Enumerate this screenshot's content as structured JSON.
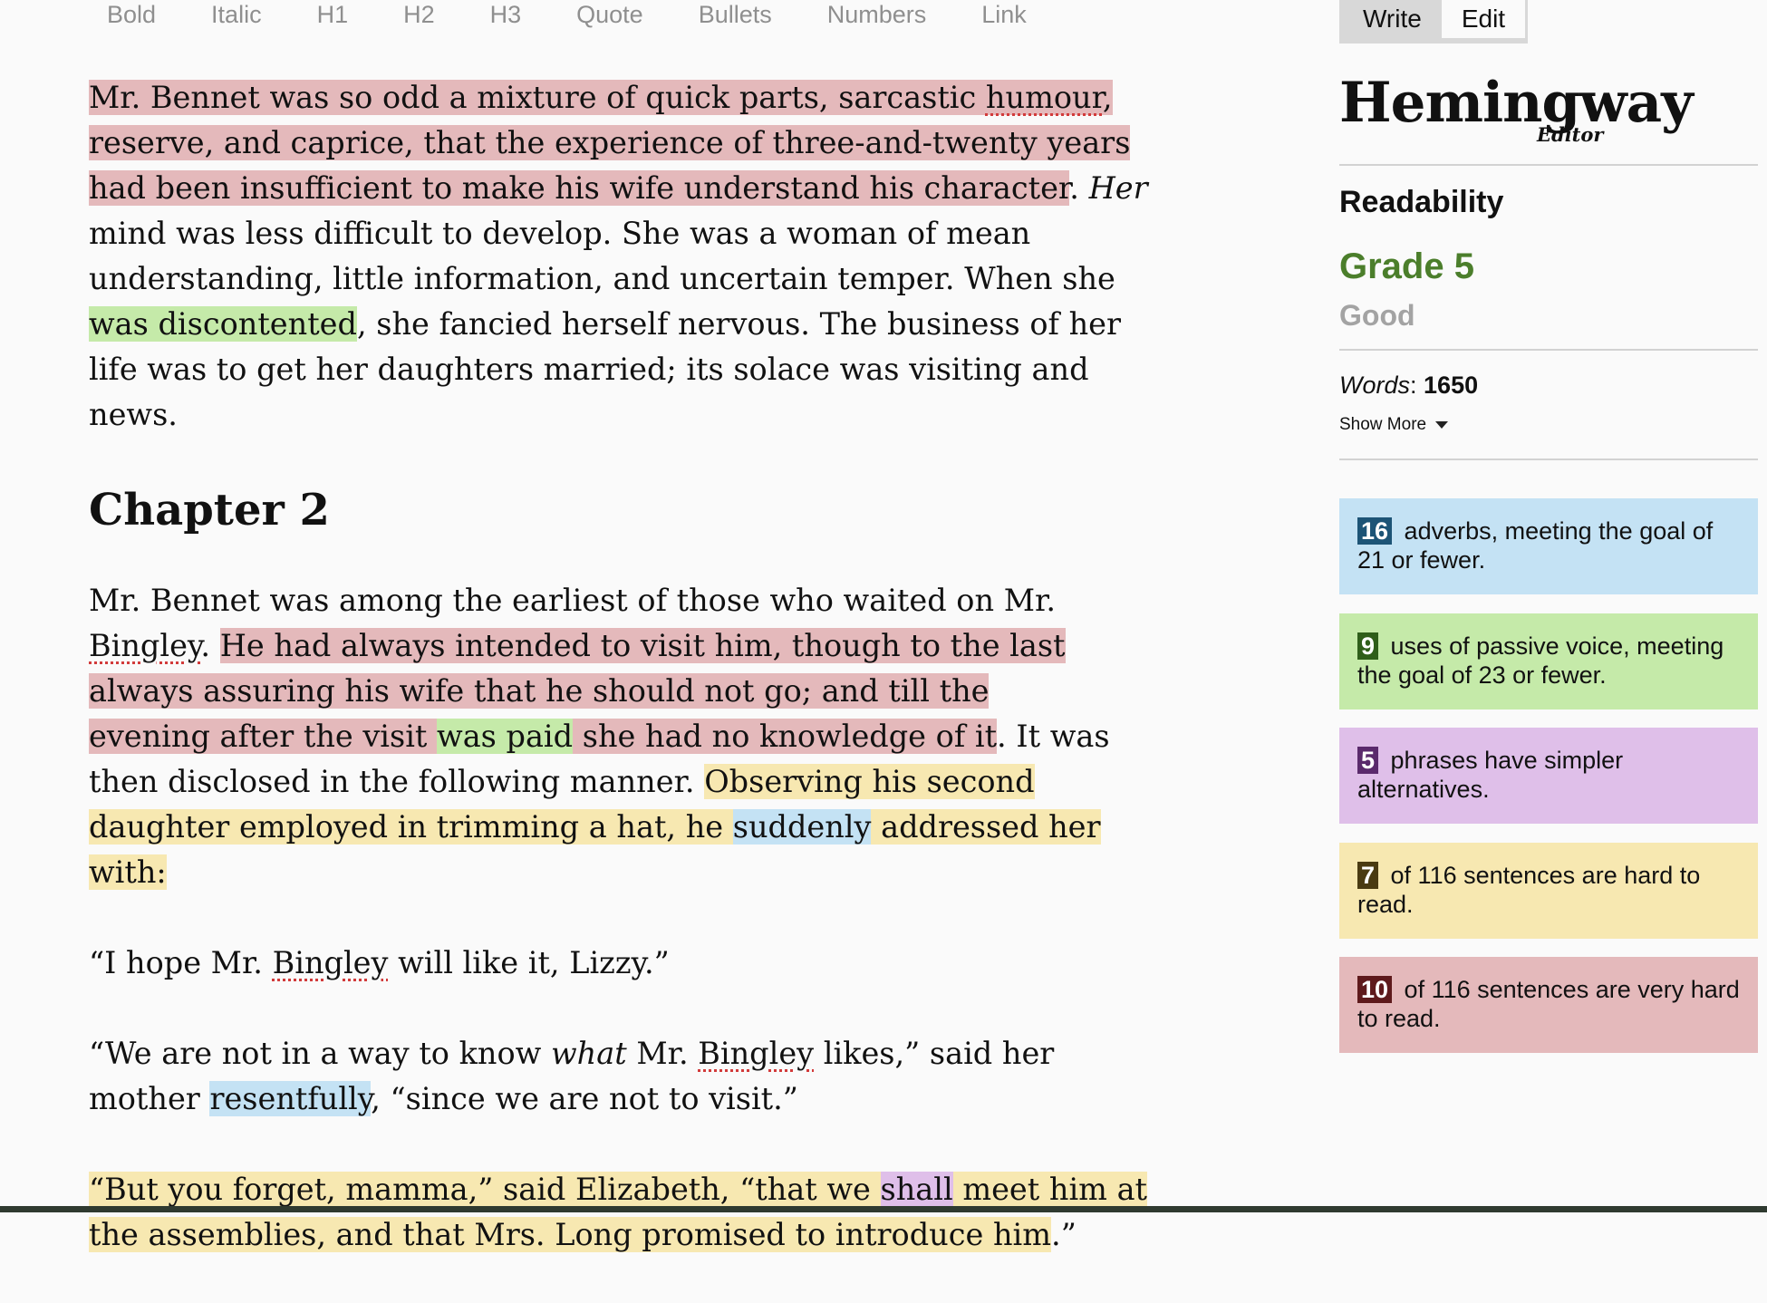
{
  "toolbar": {
    "items": [
      "Bold",
      "Italic",
      "H1",
      "H2",
      "H3",
      "Quote",
      "Bullets",
      "Numbers",
      "Link"
    ]
  },
  "editor": {
    "p1": {
      "s1": "Mr. Bennet was so odd a mixture of quick parts, sarcastic ",
      "s1_sp": "humour",
      "s1_b": ", reserve, and caprice, that the experience of three-and-twenty years had been insufficient to make his wife understand his character",
      "s1_end": ". ",
      "her": "Her",
      "s2": " mind was less difficult to develop. She was a woman of mean understanding, little information, and uncertain temper. When she ",
      "passive": "was discontented",
      "s3": ", she fancied herself nervous. The business of her life was to get her daughters married; its solace was visiting and news."
    },
    "chapter": "Chapter 2",
    "p2": {
      "a": "Mr. Bennet was among the earliest of those who waited on Mr. ",
      "a_sp": "Bingley",
      "a_end": ". ",
      "vh1": "He had always intended to visit him, though to the last always assuring his wife that he should not go; and till the evening after the visit ",
      "passive": "was paid",
      "vh2": " she had no knowledge of it",
      "b": ". It was then disclosed in the following manner. ",
      "hd1": "Observing his second daughter employed in trimming a hat, he ",
      "adverb": "suddenly",
      "hd2": " addressed her with:"
    },
    "p3": {
      "a": "“I hope Mr. ",
      "sp": "Bingley",
      "b": " will like it, Lizzy.”"
    },
    "p4": {
      "a": "“We are not in a way to know ",
      "what": "what",
      "b": " Mr. ",
      "sp": "Bingley",
      "c": " likes,” said her mother ",
      "adverb": "resentfully",
      "d": ", “since we are not to visit.”"
    },
    "p5": {
      "a": "“But you forget, mamma,” said Elizabeth, “that we ",
      "simpler": "shall",
      "b": " meet him at the assemblies, and that Mrs. Long promised to introduce him",
      "c": ".”"
    }
  },
  "sidebar": {
    "mode": {
      "write": "Write",
      "edit": "Edit"
    },
    "logo": {
      "title": "Hemingway",
      "subtitle": "Editor"
    },
    "readability_label": "Readability",
    "grade": "Grade 5",
    "grade_word": "Good",
    "words_label": "Words",
    "words_sep": ": ",
    "words_count": "1650",
    "show_more": "Show More",
    "cards": {
      "adverbs": {
        "count": "16",
        "text": " adverbs, meeting the goal of 21 or fewer."
      },
      "passive": {
        "count": "9",
        "text": " uses of passive voice, meeting the goal of 23 or fewer."
      },
      "simpler": {
        "count": "5",
        "text": " phrases have simpler alternatives."
      },
      "hard": {
        "count": "7",
        "text": " of 116 sentences are hard to read."
      },
      "veryhard": {
        "count": "10",
        "text": " of 116 sentences are very hard to read."
      }
    }
  },
  "colors": {
    "very_hard": "#e4b9bb",
    "hard": "#f7e8b1",
    "passive": "#c5eaa9",
    "adverb": "#c4e2f4",
    "simpler": "#dfbfe9",
    "grade_green": "#4b7e2b"
  }
}
